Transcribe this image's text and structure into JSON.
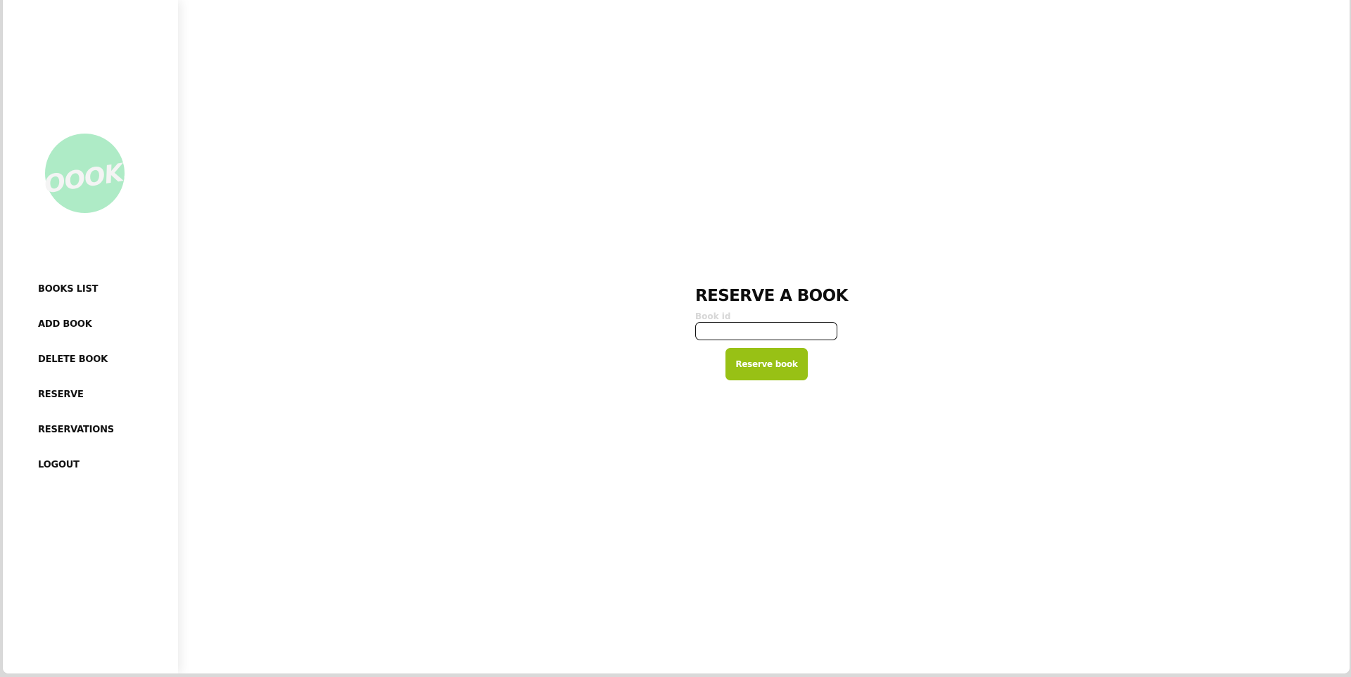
{
  "logo": {
    "text": "BOOOKS",
    "circle_color": "#aeebc6",
    "text_color": "#f4f4f4"
  },
  "sidebar": {
    "items": [
      {
        "label": "BOOKS LIST"
      },
      {
        "label": "ADD BOOK"
      },
      {
        "label": "DELETE BOOK"
      },
      {
        "label": "RESERVE"
      },
      {
        "label": "RESERVATIONS"
      },
      {
        "label": "LOGOUT"
      }
    ]
  },
  "reserve_form": {
    "title": "RESERVE A BOOK",
    "book_id_label": "Book id",
    "book_id_value": "",
    "submit_label": "Reserve book",
    "submit_color": "#98c115"
  }
}
